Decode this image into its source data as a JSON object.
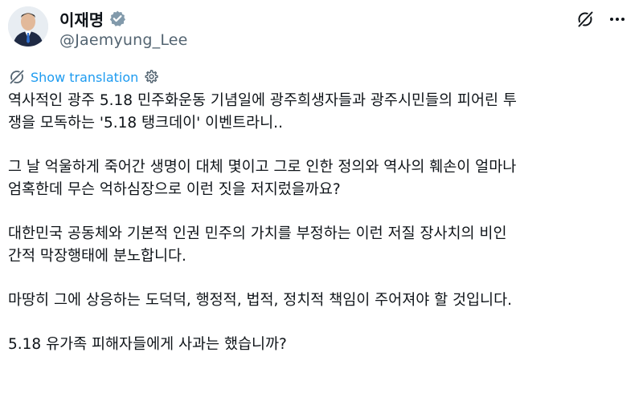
{
  "author": {
    "display_name": "이재명",
    "handle": "@Jaemyung_Lee"
  },
  "translate": {
    "label": "Show translation"
  },
  "tweet": {
    "paragraphs": [
      "역사적인 광주 5.18 민주화운동 기념일에 광주희생자들과 광주시민들의 피어린 투\n쟁을 모독하는 '5.18 탱크데이' 이벤트라니..",
      "그 날 억울하게 죽어간 생명이 대체 몇이고 그로 인한 정의와 역사의 훼손이 얼마나\n엄혹한데 무슨 억하심장으로 이런 짓을 저지렀을까요?",
      "대한민국 공동체와 기본적 인권 민주의 가치를 부정하는 이런 저질 장사치의 비인\n간적 막장행태에 분노합니다.",
      "마땅히 그에 상응하는 도덕덕, 행정적, 법적, 정치적 책임이 주어져야 할 것입니다.",
      "5.18 유가족 피해자들에게 사과는 했습니까?"
    ]
  },
  "icons": {
    "verified": "verified-badge-icon",
    "grok": "grok-icon",
    "more": "more-options-icon",
    "translate": "translate-icon",
    "settings": "settings-gear-icon"
  },
  "colors": {
    "link": "#1d9bf0",
    "secondary_text": "#536471",
    "primary_text": "#0f1419",
    "verified_badge": "#829aab"
  }
}
